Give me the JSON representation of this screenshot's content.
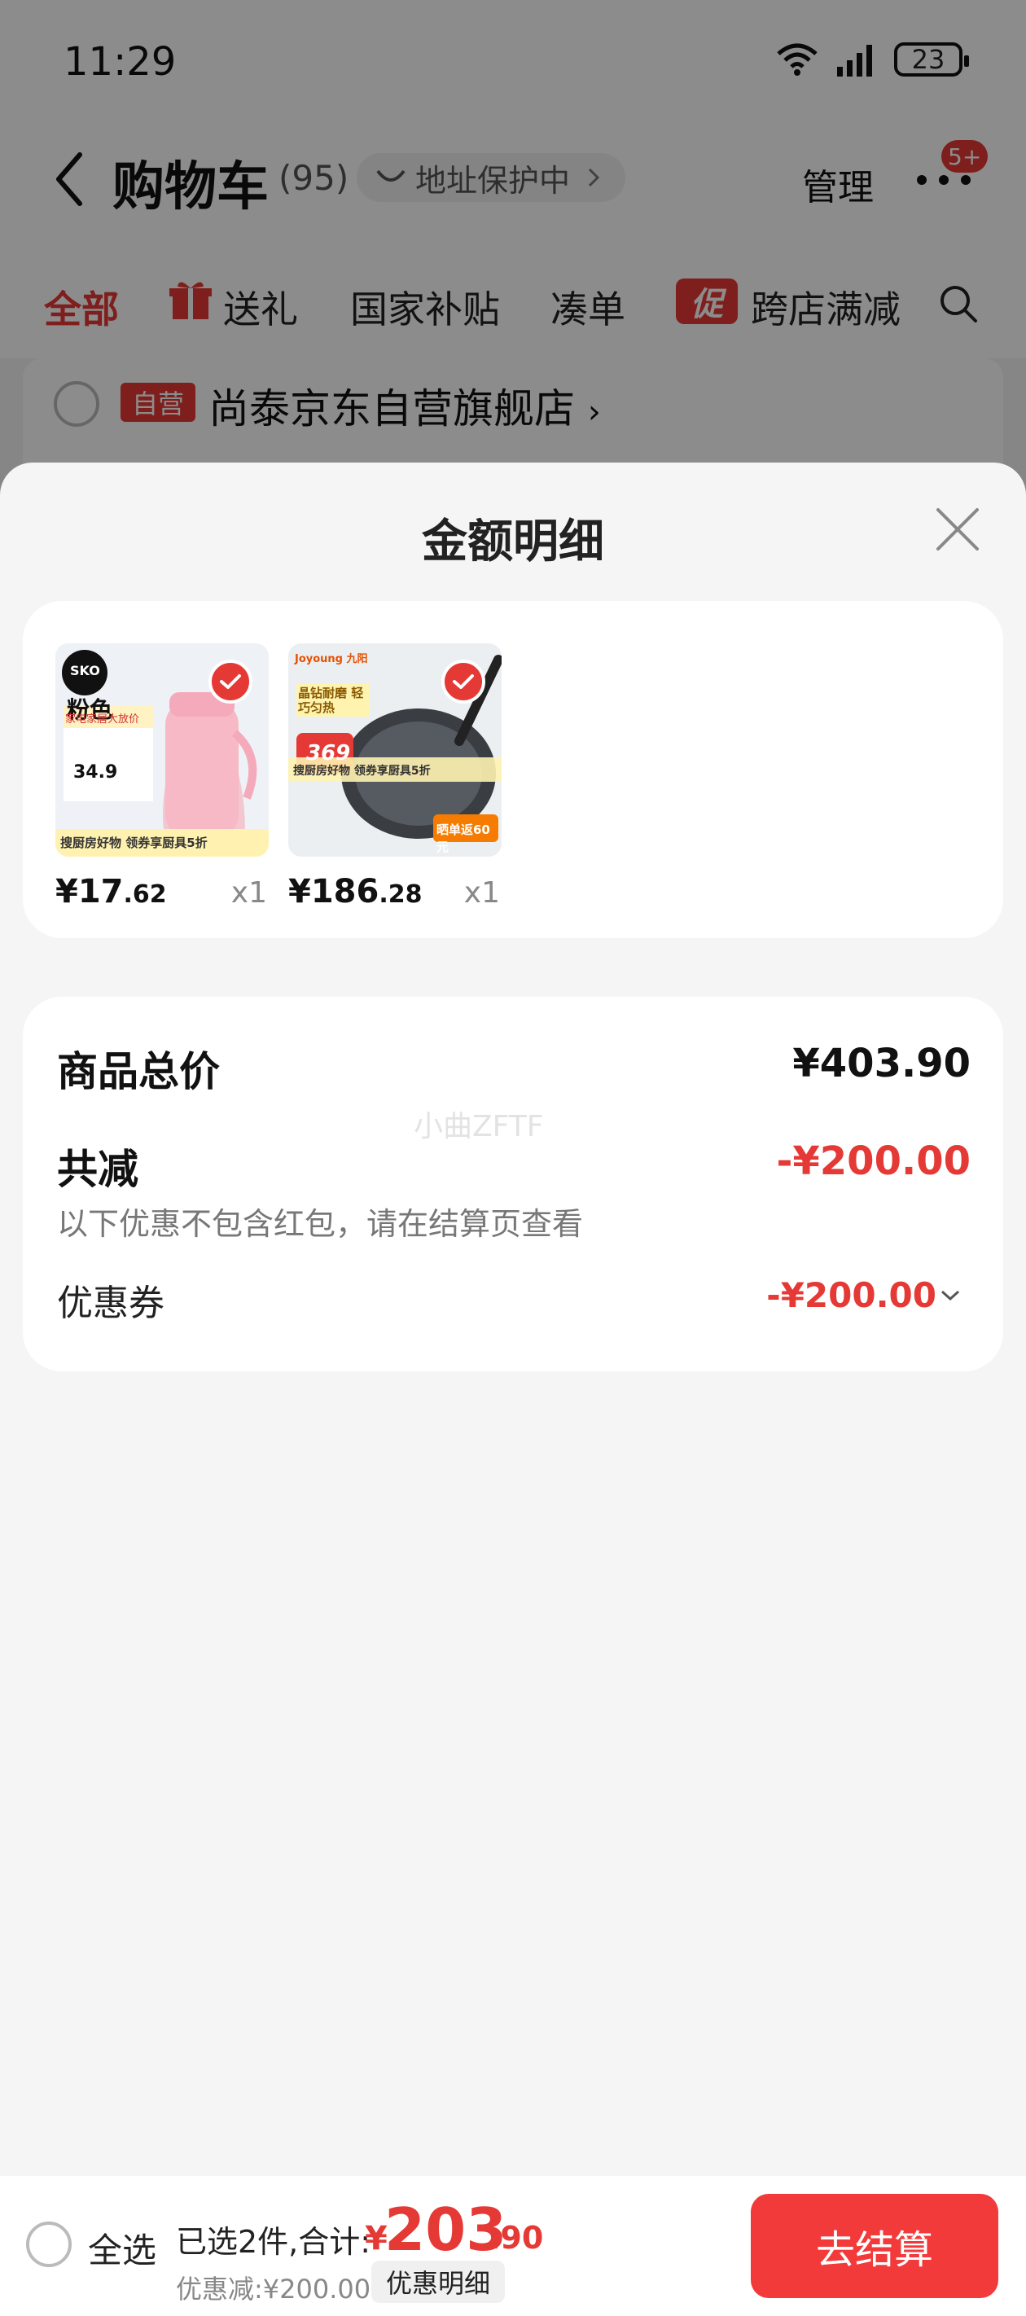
{
  "status_bar": {
    "time": "11:29",
    "battery": "23"
  },
  "nav": {
    "title": "购物车",
    "count": "(95)",
    "address_protect": "地址保护中",
    "manage": "管理",
    "badge": "5+"
  },
  "tabs": [
    {
      "label": "全部"
    },
    {
      "label": "送礼"
    },
    {
      "label": "国家补贴"
    },
    {
      "label": "凑单"
    },
    {
      "label": "跨店满减",
      "chip": "促"
    }
  ],
  "store": {
    "tag": "自营",
    "name": "尚泰京东自营旗舰店",
    "chevron": "›"
  },
  "sheet": {
    "title": "金额明细",
    "items": [
      {
        "price_int": "¥17",
        "price_dec": ".62",
        "qty": "x1",
        "img": {
          "brand": "SKO",
          "headline": "粉色",
          "promo": "家电家居大放价",
          "price_tag": "34.9",
          "bottom": "搜厨房好物 领券享厨具5折"
        }
      },
      {
        "price_int": "¥186",
        "price_dec": ".28",
        "qty": "x1",
        "img": {
          "brand": "Joyoung 九阳",
          "headline": "晶钻耐磨 轻巧匀热",
          "price_tag": "369",
          "bottom": "搜厨房好物 领券享厨具5折",
          "corner": "晒单返60元"
        }
      }
    ],
    "summary": {
      "total_label": "商品总价",
      "total_value": "¥403.90",
      "reduce_label": "共减",
      "reduce_value": "-¥200.00",
      "note": "以下优惠不包含红包，请在结算页查看",
      "coupon_label": "优惠券",
      "coupon_value": "-¥200.00",
      "watermark": "小曲ZFTF"
    }
  },
  "bottom_bar": {
    "select_all": "全选",
    "selected_text": "已选2件,合计:",
    "total_yen": "¥",
    "total_int": "203",
    "total_dec": ".90",
    "discount_line": "优惠减:¥200.00",
    "detail_chip": "优惠明细",
    "checkout": "去结算"
  },
  "colors": {
    "accent": "#e53935",
    "checkout": "#f23a3a"
  }
}
